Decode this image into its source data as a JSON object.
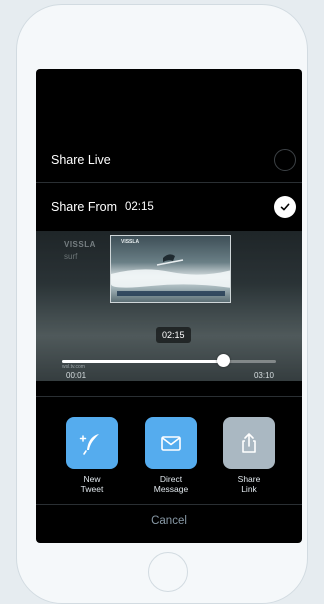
{
  "share_options": {
    "live_label": "Share Live",
    "from_label": "Share From",
    "from_time": "02:15",
    "selected": "from"
  },
  "video": {
    "watermark": "VISSLA",
    "watermark_sub": "surf",
    "thumbnail_logo": "VISSLA",
    "time_pill": "02:15",
    "start_time": "00:01",
    "end_time": "03:10",
    "corner_watermark": "wsl.tv.com",
    "scrub_progress": 0.75
  },
  "share_buttons": [
    {
      "label": "New\nTweet",
      "icon": "feather-icon",
      "color": "#55acee"
    },
    {
      "label": "Direct\nMessage",
      "icon": "envelope-icon",
      "color": "#55acee"
    },
    {
      "label": "Share\nLink",
      "icon": "share-icon",
      "color": "#aab8c2"
    }
  ],
  "cancel_label": "Cancel",
  "colors": {
    "accent_blue": "#55acee",
    "disabled_gray": "#aab8c2",
    "background": "#e6ecf0"
  }
}
